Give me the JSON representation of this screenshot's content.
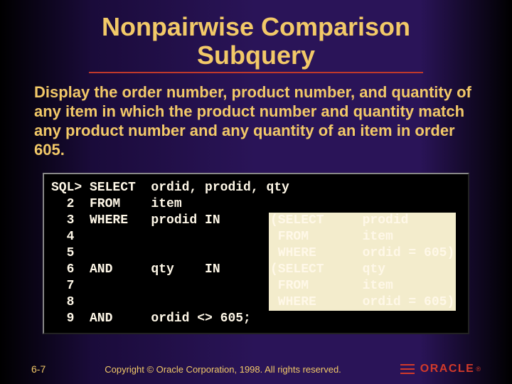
{
  "title_line1": "Nonpairwise Comparison",
  "title_line2": "Subquery",
  "description": "Display the order number, product number, and quantity of any item in which the product number and quantity match any product number and any quantity of an item in order 605.",
  "code_main": "SQL> SELECT  ordid, prodid, qty\n  2  FROM    item\n  3  WHERE   prodid IN\n  4\n  5\n  6  AND     qty    IN\n  7\n  8\n  9  AND     ordid <> 605;",
  "sub1": "(SELECT     prodid\n FROM       item\n WHERE      ordid = 605)",
  "sub2": "(SELECT     qty\n FROM       item\n WHERE      ordid = 605)",
  "page_number": "6-7",
  "copyright": "Copyright © Oracle Corporation, 1998. All rights reserved.",
  "logo_text": "ORACLE",
  "logo_reg": "®"
}
